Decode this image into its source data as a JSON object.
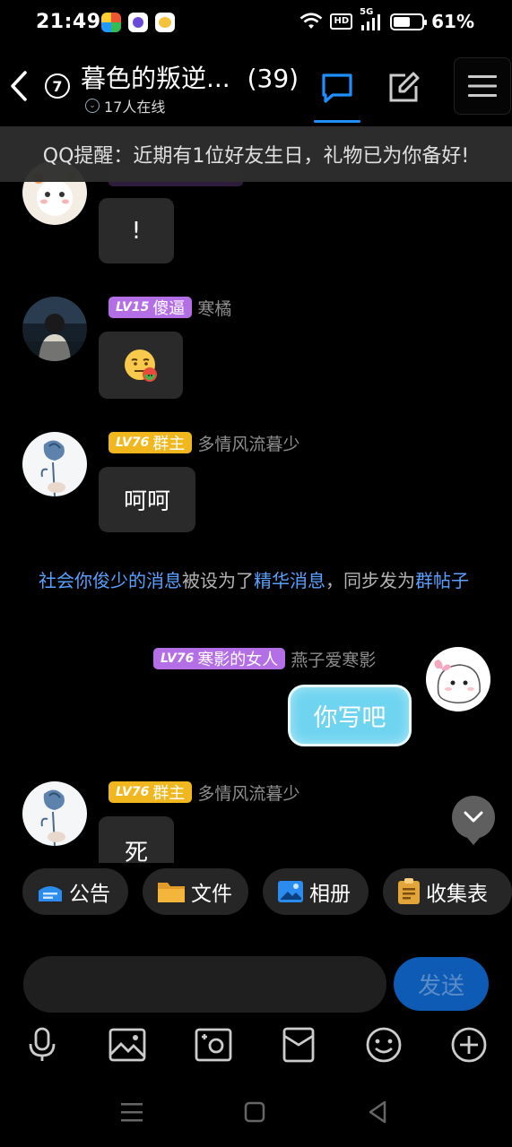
{
  "status_bar": {
    "time": "21:49",
    "network": "5G",
    "hd_label": "HD",
    "battery_percent": 61,
    "battery_text": "61%"
  },
  "header": {
    "unread_count": "7",
    "group_name": "暮色的叛逆...",
    "member_count": "(39)",
    "online_text": "17人在线",
    "accent_color": "#1e90ff"
  },
  "reminder": {
    "text": "QQ提醒：近期有1位好友生日，礼物已为你备好!"
  },
  "messages": [
    {
      "id": "m1",
      "text": "!",
      "partial": true
    },
    {
      "id": "m2",
      "level": "LV15",
      "title": "傻逼",
      "nickname": "寒橘",
      "content": "sticker",
      "sticker_icon": "emoji-sticker-icon"
    },
    {
      "id": "m3",
      "level": "LV76",
      "title": "群主",
      "nickname": "多情风流暮少",
      "text": "呵呵"
    },
    {
      "id": "m4",
      "level": "LV76",
      "title": "寒影的女人",
      "nickname": "燕子爱寒影",
      "text": "你写吧",
      "mine": true
    },
    {
      "id": "m5",
      "level": "LV76",
      "title": "群主",
      "nickname": "多情风流暮少",
      "text": "死"
    }
  ],
  "system_message": {
    "link1": "社会你俊少的消息",
    "mid": "被设为了",
    "link2": "精华消息",
    "sep": "，同步发为",
    "link3": "群帖子"
  },
  "quick_tools": [
    {
      "label": "公告",
      "icon": "announcement-icon"
    },
    {
      "label": "文件",
      "icon": "folder-icon"
    },
    {
      "label": "相册",
      "icon": "album-icon"
    },
    {
      "label": "收集表",
      "icon": "clipboard-icon"
    }
  ],
  "input": {
    "value": "",
    "send_label": "发送"
  },
  "toolbar_icons": [
    "microphone-icon",
    "image-icon",
    "camera-icon",
    "red-packet-icon",
    "emoji-icon",
    "plus-icon"
  ]
}
